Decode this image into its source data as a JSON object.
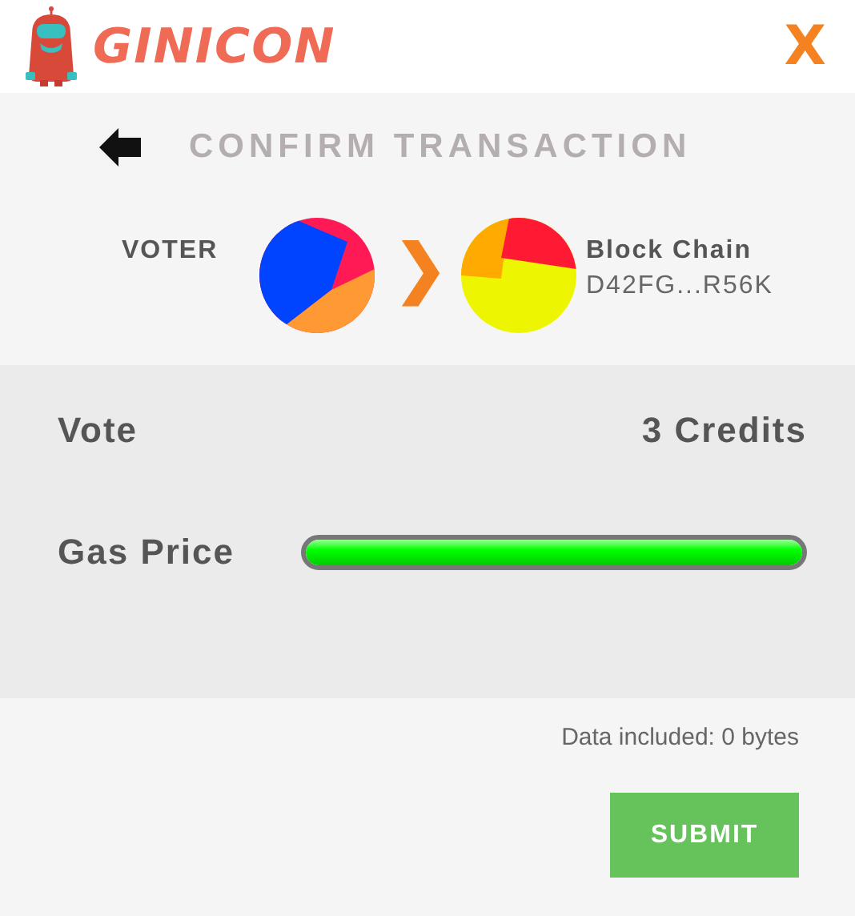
{
  "header": {
    "logo_text": "GINICON",
    "close": "X"
  },
  "title": "CONFIRM TRANSACTION",
  "transfer": {
    "from_label": "VOTER",
    "arrow": "❯",
    "to_name": "Block Chain",
    "to_address": "D42FG...R56K"
  },
  "vote": {
    "label": "Vote",
    "value": "3 Credits"
  },
  "gas": {
    "label": "Gas Price",
    "level": 1
  },
  "data_note": "Data included: 0 bytes",
  "submit": "SUBMIT"
}
